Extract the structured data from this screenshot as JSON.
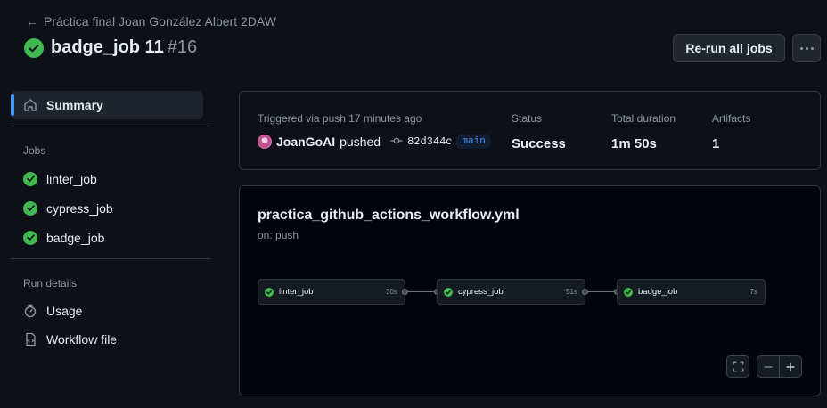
{
  "breadcrumb": {
    "label": "Práctica final Joan González Albert 2DAW"
  },
  "header": {
    "title": "badge_job 11",
    "run_number": "#16",
    "rerun_label": "Re-run all jobs"
  },
  "sidebar": {
    "summary_label": "Summary",
    "jobs_heading": "Jobs",
    "jobs": [
      {
        "label": "linter_job"
      },
      {
        "label": "cypress_job"
      },
      {
        "label": "badge_job"
      }
    ],
    "run_details_heading": "Run details",
    "usage_label": "Usage",
    "workflow_file_label": "Workflow file"
  },
  "summary": {
    "triggered_label": "Triggered via push 17 minutes ago",
    "actor": "JoanGoAI",
    "action": "pushed",
    "commit_sha": "82d344c",
    "branch": "main",
    "status_label": "Status",
    "status_value": "Success",
    "duration_label": "Total duration",
    "duration_value": "1m 50s",
    "artifacts_label": "Artifacts",
    "artifacts_value": "1"
  },
  "workflow": {
    "filename": "practica_github_actions_workflow.yml",
    "trigger": "on: push",
    "jobs": [
      {
        "name": "linter_job",
        "duration": "30s",
        "status": "success"
      },
      {
        "name": "cypress_job",
        "duration": "51s",
        "status": "success"
      },
      {
        "name": "badge_job",
        "duration": "7s",
        "status": "success"
      }
    ]
  },
  "colors": {
    "success": "#3fb950",
    "accent": "#4493f8",
    "background": "#0d1117"
  }
}
